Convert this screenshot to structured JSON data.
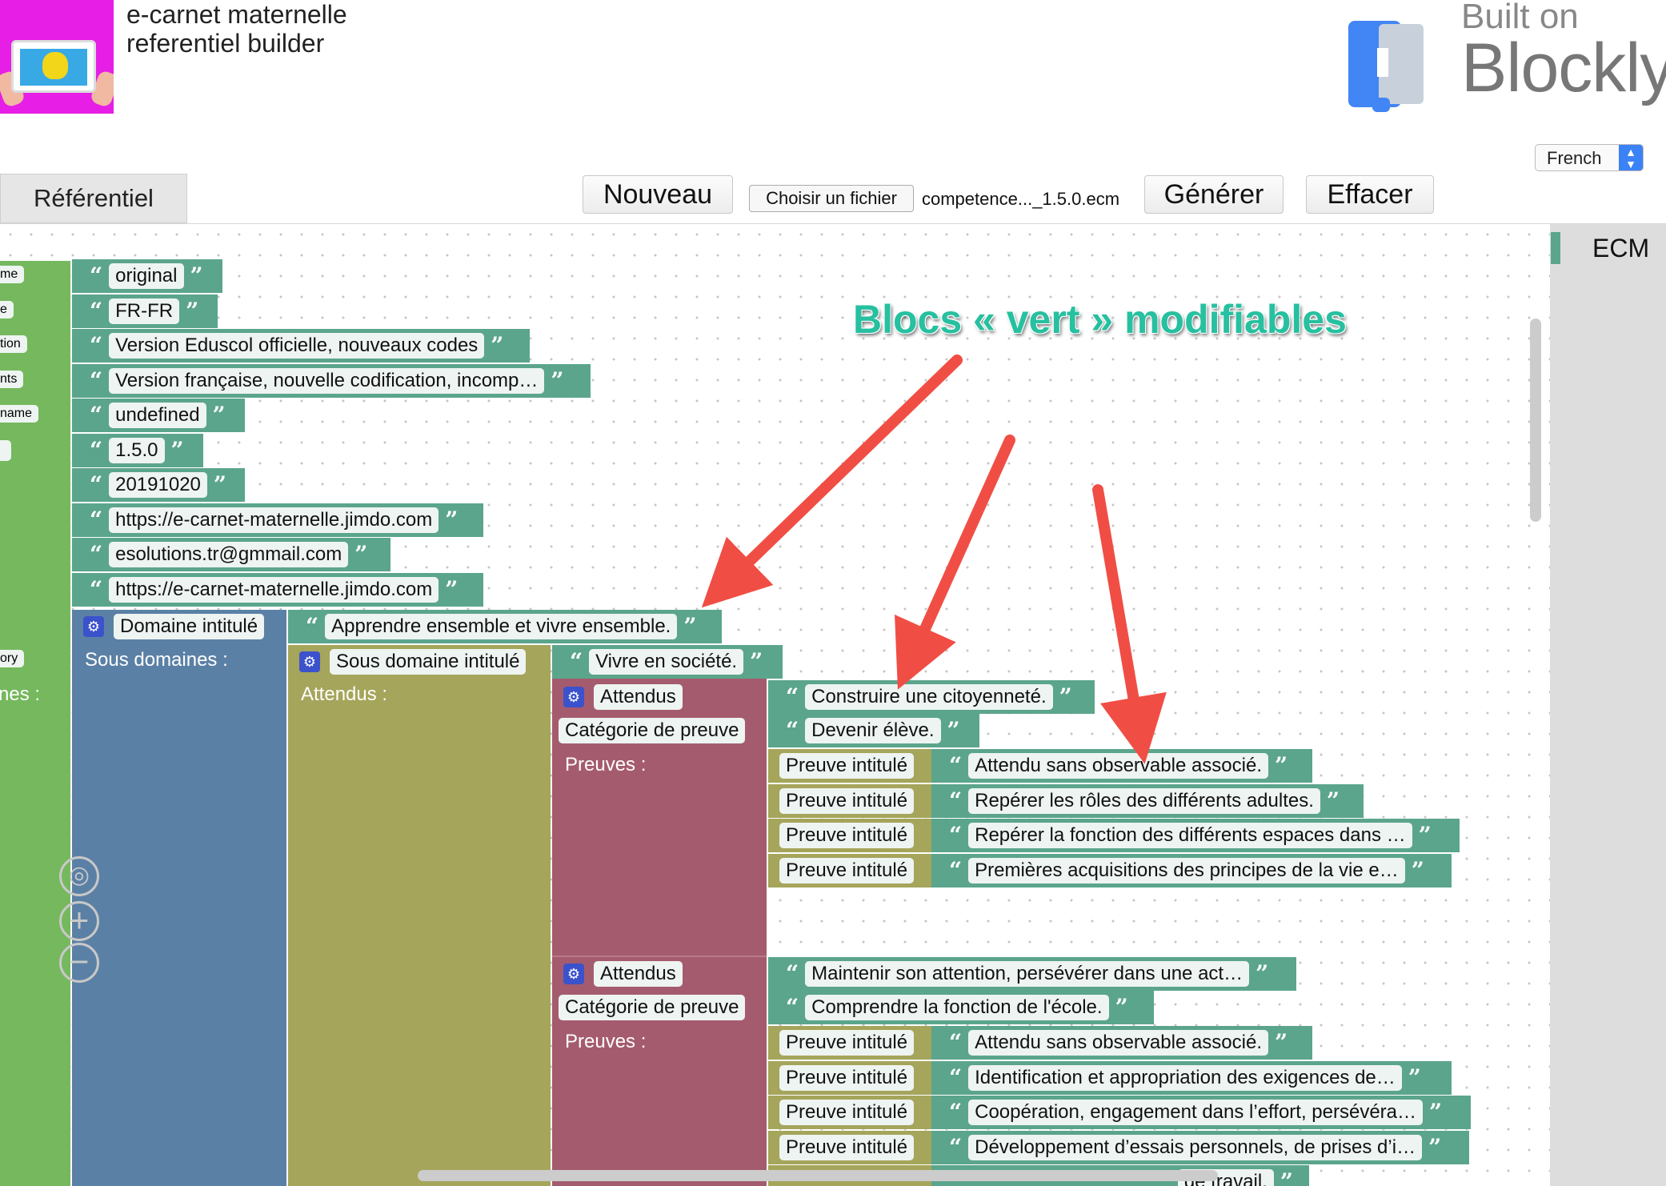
{
  "app": {
    "title_line1": "e-carnet maternelle",
    "title_line2": "referentiel builder"
  },
  "branding": {
    "built_on": "Built on",
    "name": "Blockly"
  },
  "language": {
    "selected": "French"
  },
  "tabs": [
    "Référentiel"
  ],
  "toolbar": {
    "new_label": "Nouveau",
    "file_label": "Choisir un fichier",
    "file_name": "competence..._1.5.0.ecm",
    "generate_label": "Générer",
    "clear_label": "Effacer"
  },
  "toolbox": {
    "category": "ECM",
    "category_color": "#5ba58c"
  },
  "annotation": {
    "text": "Blocs « vert » modifiables",
    "arrow_color": "#f04e45"
  },
  "colors": {
    "text_block": "#5ba58c",
    "domaine": "#5b80a5",
    "sous_domaine": "#a5a55b",
    "attendus": "#a55b6e",
    "root": "#75b85e"
  },
  "workspace": {
    "left_labels": [
      "me",
      "e",
      "tion",
      "nts",
      "name",
      "",
      "",
      "",
      "",
      "ory",
      "nes :"
    ],
    "meta_values": [
      "original",
      "FR-FR",
      "Version Eduscol officielle, nouveaux codes",
      "Version française, nouvelle codification, incomp…",
      "undefined",
      "1.5.0",
      "20191020",
      "https://e-carnet-maternelle.jimdo.com",
      "esolutions.tr@gmmail.com",
      "https://e-carnet-maternelle.jimdo.com"
    ],
    "domaine": {
      "label": "Domaine intitulé",
      "value": "Apprendre ensemble et vivre ensemble.",
      "sub_label": "Sous domaines :"
    },
    "sous_domaine": {
      "label": "Sous domaine intitulé",
      "value": "Vivre en société.",
      "sub_label": "Attendus :"
    },
    "attendus": [
      {
        "label": "Attendus",
        "value": "Construire une citoyenneté.",
        "categorie_label": "Catégorie de preuve",
        "categorie_value": "Devenir élève.",
        "preuves_label": "Preuves :",
        "preuves": [
          {
            "label": "Preuve intitulé",
            "value": "Attendu sans observable associé."
          },
          {
            "label": "Preuve intitulé",
            "value": "Repérer les rôles des différents adultes."
          },
          {
            "label": "Preuve intitulé",
            "value": "Repérer la fonction des différents espaces dans …"
          },
          {
            "label": "Preuve intitulé",
            "value": "Premières acquisitions des principes de la vie e…"
          }
        ]
      },
      {
        "label": "Attendus",
        "value": "Maintenir son attention, persévérer dans une act…",
        "categorie_label": "Catégorie de preuve",
        "categorie_value": "Comprendre la fonction de l'école.",
        "preuves_label": "Preuves :",
        "preuves": [
          {
            "label": "Preuve intitulé",
            "value": "Attendu sans observable associé."
          },
          {
            "label": "Preuve intitulé",
            "value": "Identification et appropriation des exigences de…"
          },
          {
            "label": "Preuve intitulé",
            "value": "Coopération, engagement dans l’effort, persévéra…"
          },
          {
            "label": "Preuve intitulé",
            "value": "Développement d’essais personnels, de prises d’i…"
          },
          {
            "label": "",
            "value": "de travail."
          }
        ]
      }
    ]
  }
}
